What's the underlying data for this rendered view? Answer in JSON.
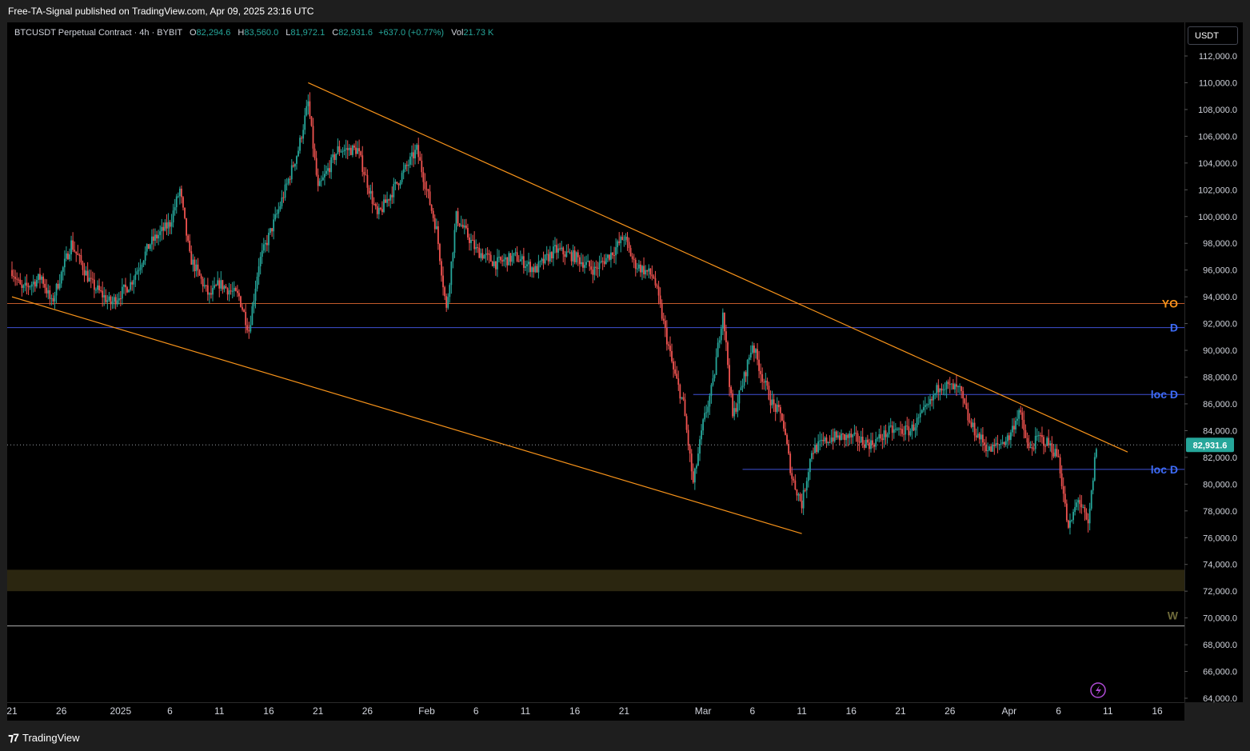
{
  "header": {
    "published": "Free-TA-Signal published on TradingView.com, Apr 09, 2025 23:16 UTC"
  },
  "legend": {
    "symbol": "BTCUSDT Perpetual Contract · 4h · BYBIT",
    "o_label": "O",
    "o_value": "82,294.6",
    "h_label": "H",
    "h_value": "83,560.0",
    "l_label": "L",
    "l_value": "81,972.1",
    "c_label": "C",
    "c_value": "82,931.6",
    "change": "+637.0 (+0.77%)",
    "vol_label": "Vol",
    "vol_value": "21.73 K"
  },
  "currency": "USDT",
  "footer": {
    "brand": "TradingView"
  },
  "colors": {
    "up": "#26a69a",
    "down": "#ef5350",
    "trendline": "#f7931a",
    "level_blue": "#3f51d5",
    "level_orange": "#c0592a",
    "zone": "#2b2610",
    "label_blue": "#3d6cf7",
    "label_orange": "#f7931a",
    "label_w": "#6e6a3a",
    "last_price_bg": "#26a69a"
  },
  "chart_data": {
    "type": "candlestick",
    "symbol": "BTCUSDT",
    "interval": "4h",
    "ylim": [
      64000,
      113000
    ],
    "y_ticks": [
      64000,
      66000,
      68000,
      70000,
      72000,
      74000,
      76000,
      78000,
      80000,
      82000,
      84000,
      86000,
      88000,
      90000,
      92000,
      94000,
      96000,
      98000,
      100000,
      102000,
      104000,
      106000,
      108000,
      110000,
      112000
    ],
    "y_tick_labels": [
      "64,000.0",
      "66,000.0",
      "68,000.0",
      "70,000.0",
      "72,000.0",
      "74,000.0",
      "76,000.0",
      "78,000.0",
      "80,000.0",
      "82,000.0",
      "84,000.0",
      "86,000.0",
      "88,000.0",
      "90,000.0",
      "92,000.0",
      "94,000.0",
      "96,000.0",
      "98,000.0",
      "100,000.0",
      "102,000.0",
      "104,000.0",
      "106,000.0",
      "108,000.0",
      "110,000.0",
      "112,000.0"
    ],
    "x_start": "2024-12-21",
    "x_end": "2025-04-16",
    "x_ticks": [
      {
        "date": "2024-12-21",
        "label": "21"
      },
      {
        "date": "2024-12-26",
        "label": "26"
      },
      {
        "date": "2025-01-01",
        "label": "2025"
      },
      {
        "date": "2025-01-06",
        "label": "6"
      },
      {
        "date": "2025-01-11",
        "label": "11"
      },
      {
        "date": "2025-01-16",
        "label": "16"
      },
      {
        "date": "2025-01-21",
        "label": "21"
      },
      {
        "date": "2025-01-26",
        "label": "26"
      },
      {
        "date": "2025-02-01",
        "label": "Feb"
      },
      {
        "date": "2025-02-06",
        "label": "6"
      },
      {
        "date": "2025-02-11",
        "label": "11"
      },
      {
        "date": "2025-02-16",
        "label": "16"
      },
      {
        "date": "2025-02-21",
        "label": "21"
      },
      {
        "date": "2025-03-01",
        "label": "Mar"
      },
      {
        "date": "2025-03-06",
        "label": "6"
      },
      {
        "date": "2025-03-11",
        "label": "11"
      },
      {
        "date": "2025-03-16",
        "label": "16"
      },
      {
        "date": "2025-03-21",
        "label": "21"
      },
      {
        "date": "2025-03-26",
        "label": "26"
      },
      {
        "date": "2025-04-01",
        "label": "Apr"
      },
      {
        "date": "2025-04-06",
        "label": "6"
      },
      {
        "date": "2025-04-11",
        "label": "11"
      },
      {
        "date": "2025-04-16",
        "label": "16"
      }
    ],
    "price_path": [
      {
        "date": "2024-12-21",
        "price": 96000
      },
      {
        "date": "2024-12-22",
        "price": 94500
      },
      {
        "date": "2024-12-24",
        "price": 95500
      },
      {
        "date": "2024-12-25",
        "price": 93500
      },
      {
        "date": "2024-12-27",
        "price": 98000
      },
      {
        "date": "2024-12-29",
        "price": 95000
      },
      {
        "date": "2024-12-31",
        "price": 93500
      },
      {
        "date": "2025-01-02",
        "price": 95000
      },
      {
        "date": "2025-01-04",
        "price": 98000
      },
      {
        "date": "2025-01-06",
        "price": 99500
      },
      {
        "date": "2025-01-07",
        "price": 102000
      },
      {
        "date": "2025-01-08",
        "price": 97000
      },
      {
        "date": "2025-01-10",
        "price": 94000
      },
      {
        "date": "2025-01-11",
        "price": 95000
      },
      {
        "date": "2025-01-13",
        "price": 94000
      },
      {
        "date": "2025-01-14",
        "price": 91500
      },
      {
        "date": "2025-01-15",
        "price": 96500
      },
      {
        "date": "2025-01-17",
        "price": 100500
      },
      {
        "date": "2025-01-19",
        "price": 105000
      },
      {
        "date": "2025-01-20",
        "price": 108500
      },
      {
        "date": "2025-01-21",
        "price": 102000
      },
      {
        "date": "2025-01-23",
        "price": 105000
      },
      {
        "date": "2025-01-25",
        "price": 105000
      },
      {
        "date": "2025-01-27",
        "price": 100000
      },
      {
        "date": "2025-01-29",
        "price": 102500
      },
      {
        "date": "2025-01-31",
        "price": 105000
      },
      {
        "date": "2025-02-01",
        "price": 102000
      },
      {
        "date": "2025-02-02",
        "price": 99000
      },
      {
        "date": "2025-02-03",
        "price": 93000
      },
      {
        "date": "2025-02-04",
        "price": 100000
      },
      {
        "date": "2025-02-06",
        "price": 97500
      },
      {
        "date": "2025-02-08",
        "price": 96500
      },
      {
        "date": "2025-02-10",
        "price": 97000
      },
      {
        "date": "2025-02-12",
        "price": 96000
      },
      {
        "date": "2025-02-14",
        "price": 97500
      },
      {
        "date": "2025-02-16",
        "price": 97000
      },
      {
        "date": "2025-02-18",
        "price": 96000
      },
      {
        "date": "2025-02-20",
        "price": 97500
      },
      {
        "date": "2025-02-21",
        "price": 98500
      },
      {
        "date": "2025-02-22",
        "price": 96500
      },
      {
        "date": "2025-02-24",
        "price": 95500
      },
      {
        "date": "2025-02-25",
        "price": 92000
      },
      {
        "date": "2025-02-26",
        "price": 88500
      },
      {
        "date": "2025-02-27",
        "price": 86000
      },
      {
        "date": "2025-02-28",
        "price": 80000
      },
      {
        "date": "2025-03-01",
        "price": 84500
      },
      {
        "date": "2025-03-02",
        "price": 87500
      },
      {
        "date": "2025-03-03",
        "price": 93000
      },
      {
        "date": "2025-03-04",
        "price": 85000
      },
      {
        "date": "2025-03-05",
        "price": 87500
      },
      {
        "date": "2025-03-06",
        "price": 90500
      },
      {
        "date": "2025-03-07",
        "price": 88000
      },
      {
        "date": "2025-03-08",
        "price": 86000
      },
      {
        "date": "2025-03-09",
        "price": 85000
      },
      {
        "date": "2025-03-10",
        "price": 80500
      },
      {
        "date": "2025-03-11",
        "price": 78500
      },
      {
        "date": "2025-03-12",
        "price": 82500
      },
      {
        "date": "2025-03-14",
        "price": 83500
      },
      {
        "date": "2025-03-16",
        "price": 83500
      },
      {
        "date": "2025-03-18",
        "price": 83000
      },
      {
        "date": "2025-03-20",
        "price": 84000
      },
      {
        "date": "2025-03-22",
        "price": 84000
      },
      {
        "date": "2025-03-24",
        "price": 86000
      },
      {
        "date": "2025-03-25",
        "price": 87500
      },
      {
        "date": "2025-03-27",
        "price": 87000
      },
      {
        "date": "2025-03-28",
        "price": 84500
      },
      {
        "date": "2025-03-30",
        "price": 82500
      },
      {
        "date": "2025-04-01",
        "price": 83500
      },
      {
        "date": "2025-04-02",
        "price": 85500
      },
      {
        "date": "2025-04-03",
        "price": 82500
      },
      {
        "date": "2025-04-04",
        "price": 83500
      },
      {
        "date": "2025-04-05",
        "price": 83000
      },
      {
        "date": "2025-04-06",
        "price": 82000
      },
      {
        "date": "2025-04-07",
        "price": 76500
      },
      {
        "date": "2025-04-08",
        "price": 79000
      },
      {
        "date": "2025-04-09",
        "price": 76800
      },
      {
        "date": "2025-04-09T20:00",
        "price": 82931.6
      }
    ],
    "trendlines": [
      {
        "name": "upper",
        "from": {
          "date": "2025-01-20",
          "price": 110000
        },
        "to": {
          "date": "2025-04-13",
          "price": 82400
        }
      },
      {
        "name": "lower",
        "from": {
          "date": "2024-12-21",
          "price": 94000
        },
        "to": {
          "date": "2025-03-11",
          "price": 76300
        }
      }
    ],
    "levels": [
      {
        "name": "YO",
        "price": 93500,
        "color": "#c0592a",
        "label": "YO"
      },
      {
        "name": "D",
        "price": 91700,
        "color": "#3f51d5",
        "label": "D"
      },
      {
        "name": "loc D",
        "price": 86700,
        "color": "#3f51d5",
        "label": "loc D",
        "from": "2025-02-28"
      },
      {
        "name": "loc D",
        "price": 81100,
        "color": "#3f51d5",
        "label": "loc D",
        "from": "2025-03-05"
      },
      {
        "name": "W",
        "price": 69400,
        "color": "#b0b0b0",
        "label": "W"
      }
    ],
    "zone": {
      "from_price": 72000,
      "to_price": 73600,
      "color": "#2b2610"
    },
    "last_price": 82931.6,
    "last_price_label": "82,931.6"
  }
}
